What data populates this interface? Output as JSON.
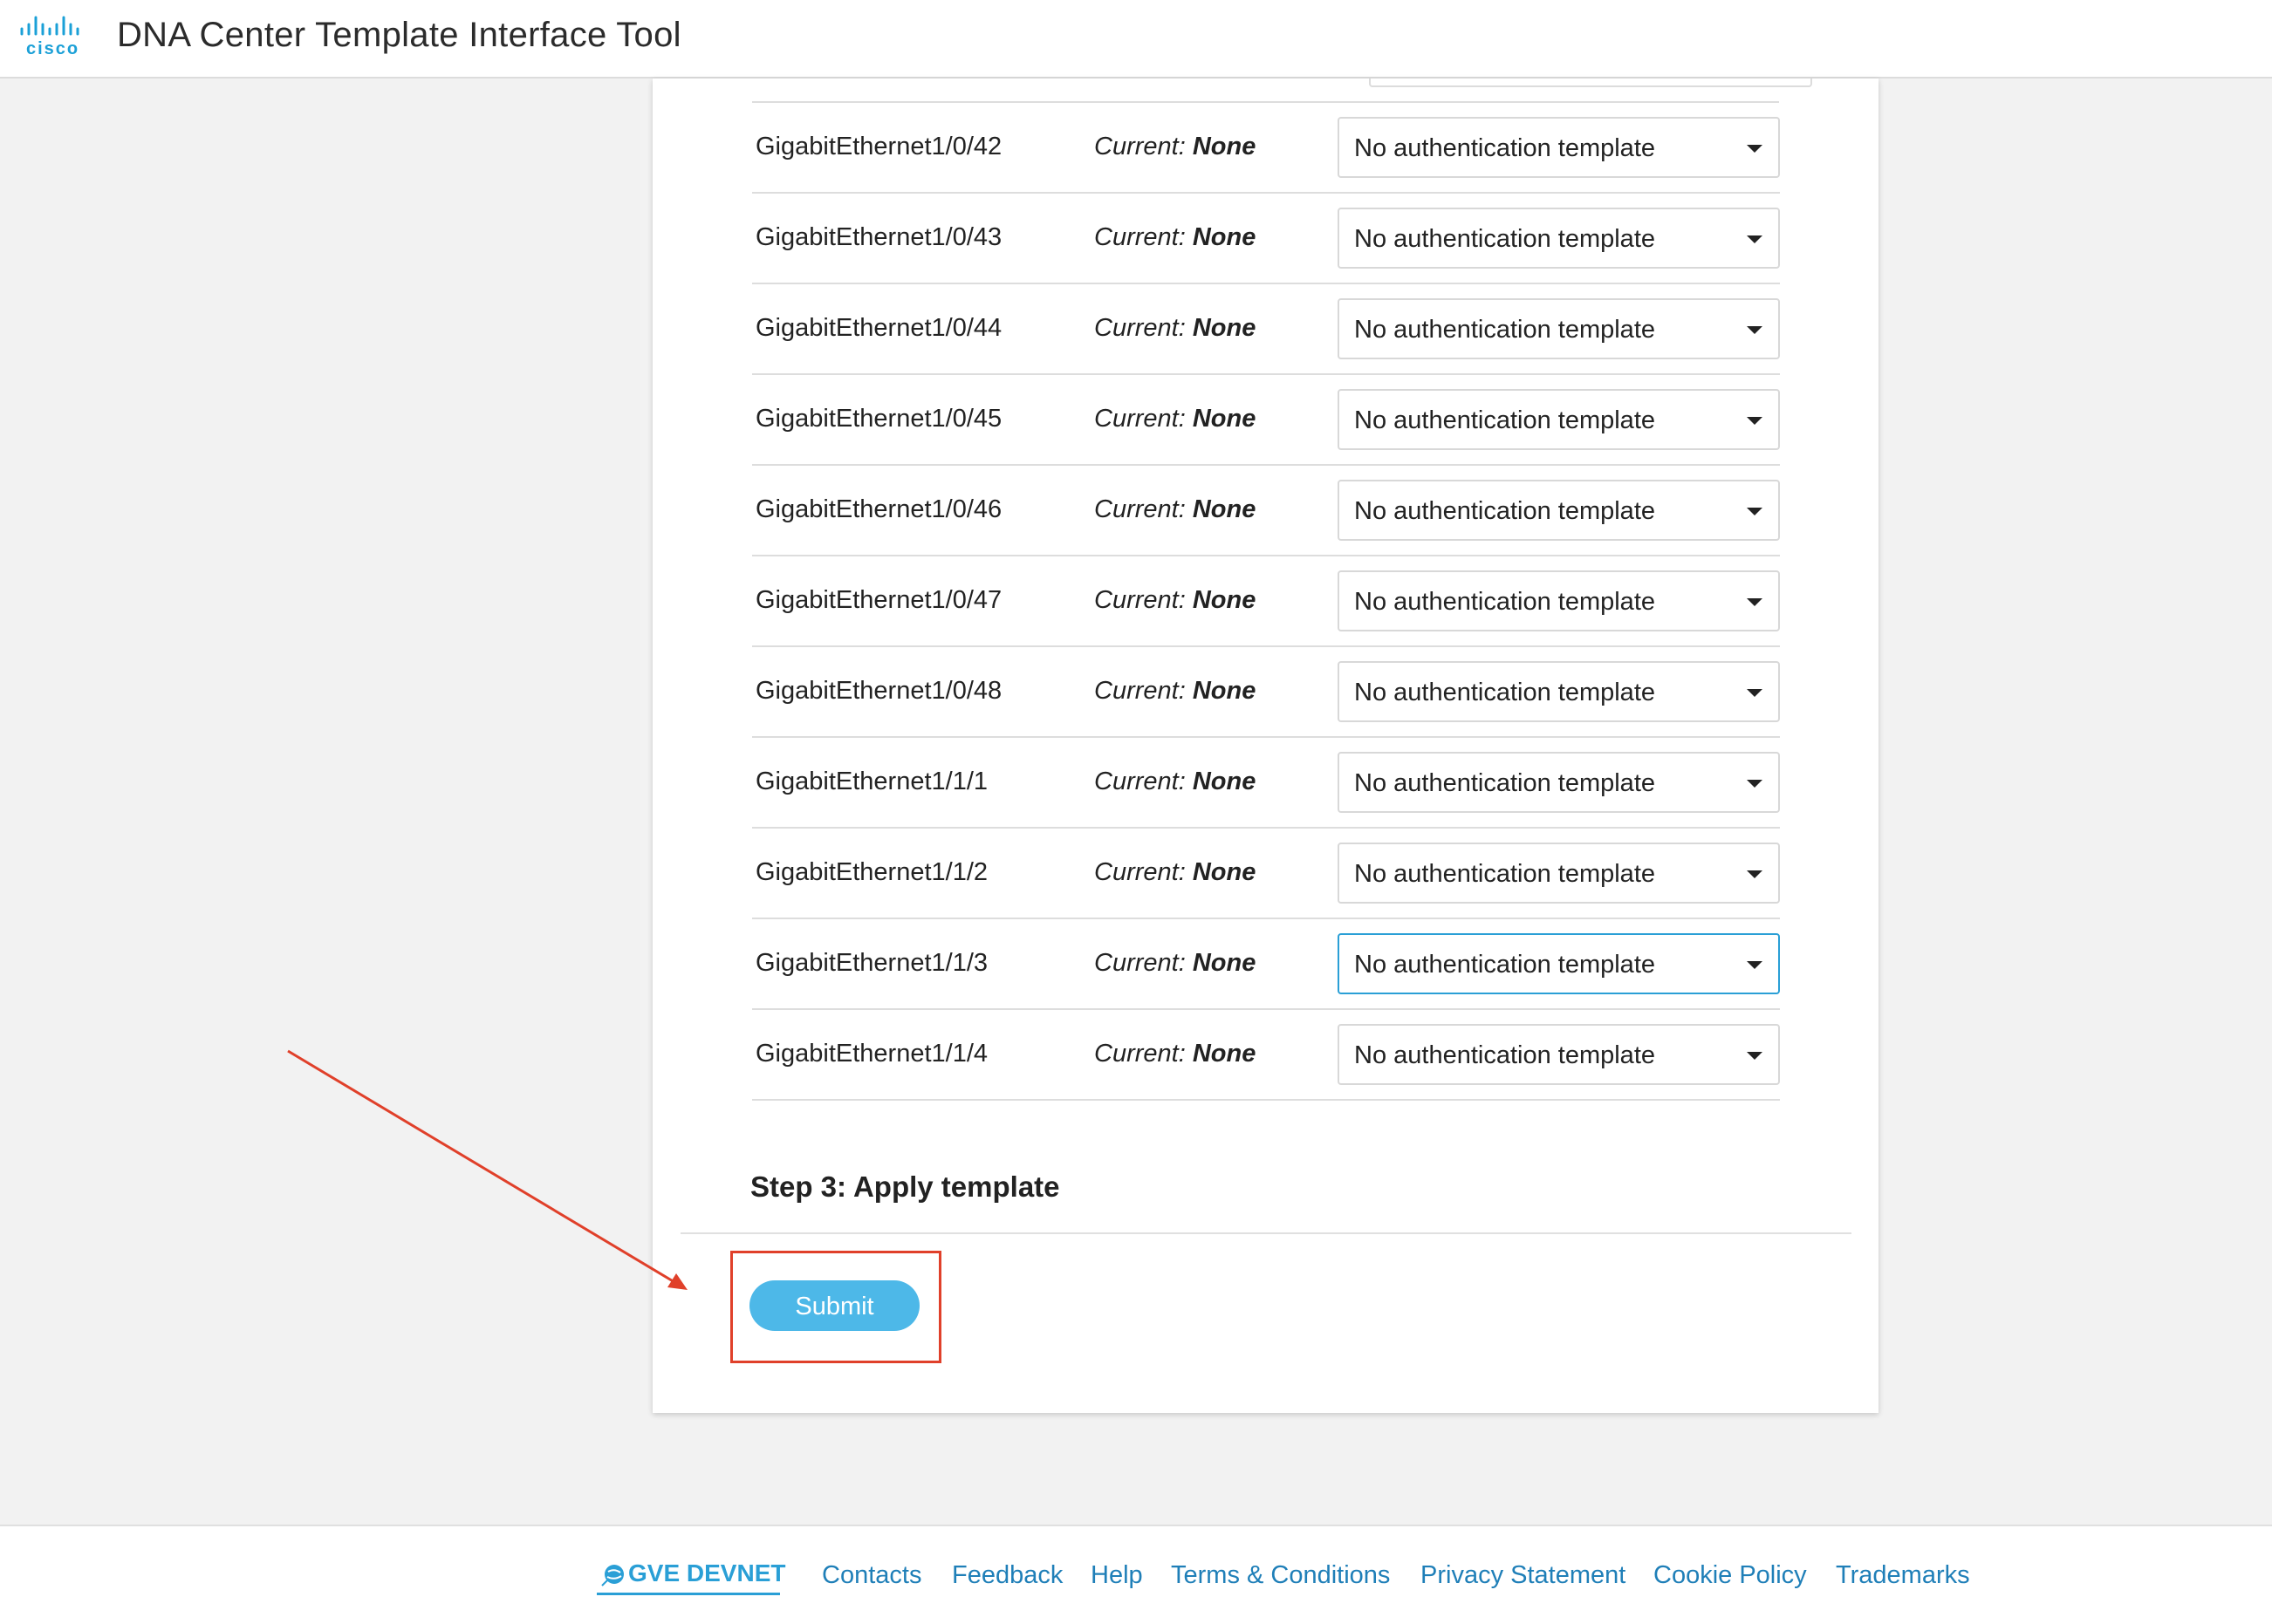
{
  "header": {
    "brand": "cisco",
    "title": "DNA Center Template Interface Tool"
  },
  "interfaces": [
    {
      "name": "GigabitEthernet1/0/42",
      "current_label": "Current:",
      "current_value": "None",
      "selected": "No authentication template"
    },
    {
      "name": "GigabitEthernet1/0/43",
      "current_label": "Current:",
      "current_value": "None",
      "selected": "No authentication template"
    },
    {
      "name": "GigabitEthernet1/0/44",
      "current_label": "Current:",
      "current_value": "None",
      "selected": "No authentication template"
    },
    {
      "name": "GigabitEthernet1/0/45",
      "current_label": "Current:",
      "current_value": "None",
      "selected": "No authentication template"
    },
    {
      "name": "GigabitEthernet1/0/46",
      "current_label": "Current:",
      "current_value": "None",
      "selected": "No authentication template"
    },
    {
      "name": "GigabitEthernet1/0/47",
      "current_label": "Current:",
      "current_value": "None",
      "selected": "No authentication template"
    },
    {
      "name": "GigabitEthernet1/0/48",
      "current_label": "Current:",
      "current_value": "None",
      "selected": "No authentication template"
    },
    {
      "name": "GigabitEthernet1/1/1",
      "current_label": "Current:",
      "current_value": "None",
      "selected": "No authentication template"
    },
    {
      "name": "GigabitEthernet1/1/2",
      "current_label": "Current:",
      "current_value": "None",
      "selected": "No authentication template"
    },
    {
      "name": "GigabitEthernet1/1/3",
      "current_label": "Current:",
      "current_value": "None",
      "selected": "No authentication template",
      "focused": true
    },
    {
      "name": "GigabitEthernet1/1/4",
      "current_label": "Current:",
      "current_value": "None",
      "selected": "No authentication template"
    }
  ],
  "step3": {
    "title": "Step 3: Apply template",
    "submit_label": "Submit"
  },
  "footer": {
    "devnet_label": "GVE DEVNET",
    "links": [
      "Contacts",
      "Feedback",
      "Help",
      "Terms & Conditions",
      "Privacy Statement",
      "Cookie Policy",
      "Trademarks"
    ]
  },
  "colors": {
    "accent": "#4db8e8",
    "link": "#1f7fb8",
    "annotation": "#e0402a"
  },
  "icons": {
    "logo": "cisco-logo-icon",
    "caret": "chevron-down-icon",
    "globe": "globe-icon",
    "annotation": "arrow-icon"
  }
}
